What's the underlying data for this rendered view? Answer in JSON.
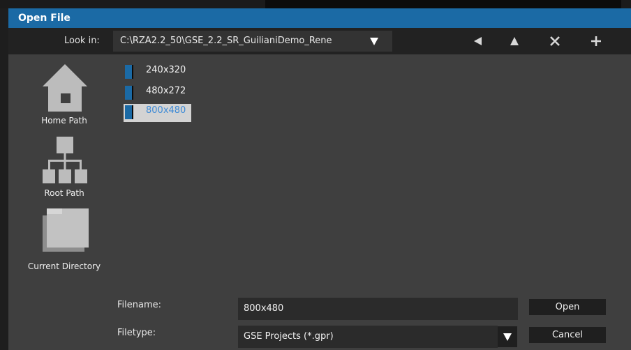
{
  "dialog": {
    "title": "Open File"
  },
  "toolbar": {
    "look_in_label": "Look in:",
    "path": "C:\\RZA2.2_50\\GSE_2.2_SR_GuilianiDemo_Rene",
    "buttons": [
      "back-arrow-icon",
      "up-arrow-icon",
      "close-icon",
      "plus-icon"
    ]
  },
  "sidebar": {
    "items": [
      {
        "label": "Home Path",
        "icon": "home-icon"
      },
      {
        "label": "Root Path",
        "icon": "tree-icon"
      },
      {
        "label": "Current Directory",
        "icon": "folder-icon"
      }
    ]
  },
  "files": [
    {
      "name": "240x320",
      "selected": false,
      "icon": "folder-icon"
    },
    {
      "name": "480x272",
      "selected": false,
      "icon": "folder-icon"
    },
    {
      "name": "800x480",
      "selected": true,
      "icon": "folder-icon"
    }
  ],
  "bottom": {
    "filename_label": "Filename:",
    "filename_value": "800x480",
    "filetype_label": "Filetype:",
    "filetype_value": "GSE Projects (*.gpr)",
    "open_label": "Open",
    "cancel_label": "Cancel"
  },
  "colors": {
    "accent": "#1b6aa5",
    "folder": "#1b6aa5",
    "selected_text": "#3d8ad6",
    "panel": "#3f3f3f"
  }
}
